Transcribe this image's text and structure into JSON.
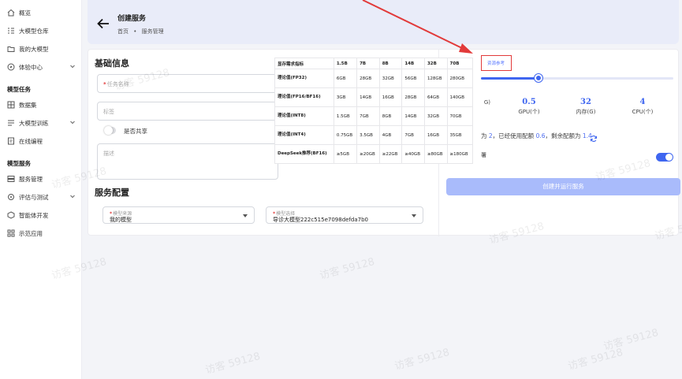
{
  "sidebar": {
    "items": [
      {
        "label": "概览",
        "icon": "home-icon"
      },
      {
        "label": "大模型仓库",
        "icon": "repository-icon"
      },
      {
        "label": "我的大模型",
        "icon": "folder-icon"
      },
      {
        "label": "体验中心",
        "icon": "compass-icon"
      },
      {
        "label": "数据集",
        "icon": "grid-icon"
      },
      {
        "label": "大模型训练",
        "icon": "training-icon"
      },
      {
        "label": "在线编程",
        "icon": "code-icon"
      },
      {
        "label": "服务管理",
        "icon": "server-icon"
      },
      {
        "label": "评估与测试",
        "icon": "evaluate-icon"
      },
      {
        "label": "智能体开发",
        "icon": "agent-icon"
      },
      {
        "label": "示范应用",
        "icon": "apps-icon"
      }
    ],
    "sections": [
      "模型任务",
      "模型服务"
    ]
  },
  "header": {
    "title": "创建服务",
    "breadcrumb_home": "首页",
    "breadcrumb_sep": "•",
    "breadcrumb_current": "服务管理"
  },
  "basic": {
    "title": "基础信息",
    "task_name_placeholder": "任务名称",
    "tag_placeholder": "标签",
    "share_label": "是否共享",
    "desc_placeholder": "描述",
    "required_mark": "*"
  },
  "service": {
    "title": "服务配置",
    "source_label": "模型来源",
    "source_value": "我的模型",
    "model_label": "模型选择",
    "model_value": "导诊大模型222c515e7098defda7b0"
  },
  "resources": {
    "ref_button": "资源参考",
    "slider_value": 0.3,
    "stats": [
      {
        "value": "",
        "label": "G)"
      },
      {
        "value": "0.5",
        "label": "GPU(个)"
      },
      {
        "value": "32",
        "label": "内存(G)"
      },
      {
        "value": "4",
        "label": "CPU(个)"
      }
    ],
    "info_prefix": "为",
    "total": "2",
    "info_mid": "，已经使用配额",
    "used": "0.6",
    "info_suffix": "，剩余配额为",
    "remain": "1.4",
    "deploy_label": "署",
    "run_button": "创建并运行服务"
  },
  "ref_table": {
    "headers": [
      "显存需求指标",
      "1.5B",
      "7B",
      "8B",
      "14B",
      "32B",
      "70B"
    ],
    "rows": [
      [
        "理论值(FP32)",
        "6GB",
        "28GB",
        "32GB",
        "56GB",
        "128GB",
        "280GB"
      ],
      [
        "理论值(FP16/BF16)",
        "3GB",
        "14GB",
        "16GB",
        "28GB",
        "64GB",
        "140GB"
      ],
      [
        "理论值(INT8)",
        "1.5GB",
        "7GB",
        "8GB",
        "14GB",
        "32GB",
        "70GB"
      ],
      [
        "理论值(INT4)",
        "0.75GB",
        "3.5GB",
        "4GB",
        "7GB",
        "16GB",
        "35GB"
      ],
      [
        "DeepSeek推荐(BF16)",
        "≥5GB",
        "≥20GB",
        "≥22GB",
        "≥40GB",
        "≥80GB",
        "≥180GB"
      ]
    ]
  },
  "watermark": "访客 59128",
  "colors": {
    "accent": "#3f66f0",
    "highlight": "#e23a3a",
    "header_bg": "#e9ecf9",
    "run_button": "#a9bbfb"
  }
}
